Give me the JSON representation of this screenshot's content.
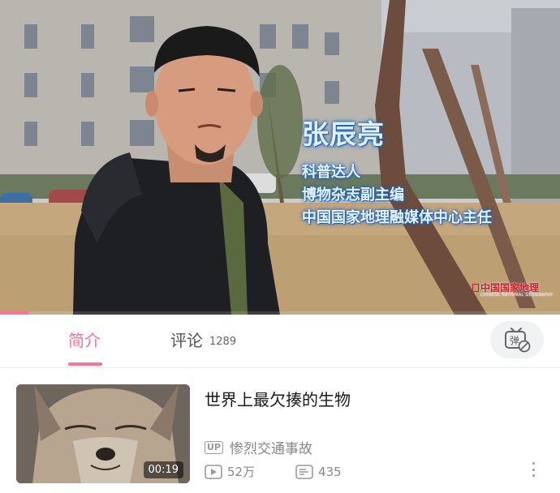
{
  "player": {
    "caption_name": "张辰亮",
    "caption_lines": [
      "科普达人",
      "博物杂志副主编",
      "中国国家地理融媒体中心主任"
    ],
    "watermark": "中国国家地理",
    "watermark_sub": "CHINESE NATIONAL GEOGRAPHY",
    "progress_fraction": 0.05
  },
  "tabs": {
    "intro_label": "简介",
    "comments_label": "评论",
    "comments_count": "1289",
    "danmaku_icon": "danmaku-toggle-icon",
    "danmaku_text": "弹"
  },
  "related_video": {
    "title": "世界上最欠揍的生物",
    "up_badge": "UP",
    "uploader": "惨烈交通事故",
    "duration": "00:19",
    "views": "52万",
    "danmaku_count": "435",
    "icons": [
      "play-count-icon",
      "danmaku-count-icon",
      "more-icon"
    ]
  },
  "colors": {
    "accent": "#fb7299",
    "caption": "#1a5fb4"
  }
}
